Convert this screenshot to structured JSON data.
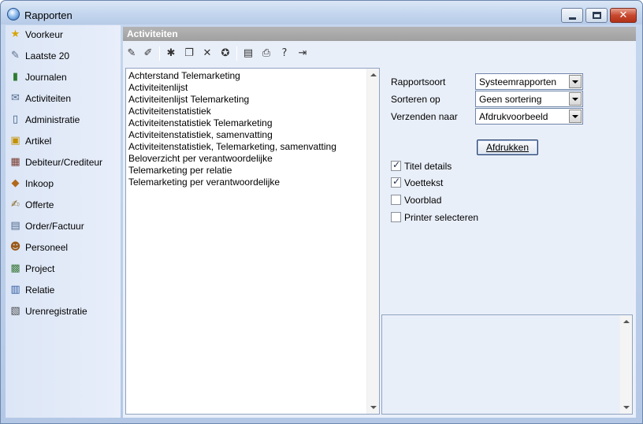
{
  "window": {
    "title": "Rapporten",
    "close_glyph": "✕"
  },
  "sidebar": {
    "items": [
      {
        "label": "Voorkeur",
        "icon": "★",
        "color": "#d8a400"
      },
      {
        "label": "Laatste 20",
        "icon": "✎",
        "color": "#5a6e8c"
      },
      {
        "label": "Journalen",
        "icon": "▮",
        "color": "#2e7d32"
      },
      {
        "label": "Activiteiten",
        "icon": "✉",
        "color": "#556b8f"
      },
      {
        "label": "Administratie",
        "icon": "▯",
        "color": "#3a5a86"
      },
      {
        "label": "Artikel",
        "icon": "▣",
        "color": "#c49000"
      },
      {
        "label": "Debiteur/Crediteur",
        "icon": "▦",
        "color": "#7a3b2e"
      },
      {
        "label": "Inkoop",
        "icon": "◆",
        "color": "#b06a1a"
      },
      {
        "label": "Offerte",
        "icon": "✍",
        "color": "#8a6a2a"
      },
      {
        "label": "Order/Factuur",
        "icon": "▤",
        "color": "#4f6a8f"
      },
      {
        "label": "Personeel",
        "icon": "☻",
        "color": "#9a5a1a"
      },
      {
        "label": "Project",
        "icon": "▩",
        "color": "#3c7a3c"
      },
      {
        "label": "Relatie",
        "icon": "▥",
        "color": "#2f5aa0"
      },
      {
        "label": "Urenregistratie",
        "icon": "▧",
        "color": "#4a4a4a"
      }
    ]
  },
  "main": {
    "header": "Activiteiten",
    "toolbar": {
      "buttons": [
        {
          "name": "edit-icon",
          "glyph": "✎"
        },
        {
          "name": "edit-alt-icon",
          "glyph": "✐"
        },
        {
          "name": "new-icon",
          "glyph": "✱"
        },
        {
          "name": "copy-icon",
          "glyph": "❐"
        },
        {
          "name": "delete-icon",
          "glyph": "✕"
        },
        {
          "name": "favorite-icon",
          "glyph": "✪"
        },
        {
          "name": "properties-icon",
          "glyph": "▤"
        },
        {
          "name": "print-icon",
          "glyph": "⎙"
        },
        {
          "name": "help-icon",
          "glyph": "?"
        },
        {
          "name": "exit-icon",
          "glyph": "⇥"
        }
      ]
    },
    "reports": [
      "Achterstand Telemarketing",
      "Activiteitenlijst",
      "Activiteitenlijst Telemarketing",
      "Activiteitenstatistiek",
      "Activiteitenstatistiek Telemarketing",
      "Activiteitenstatistiek, samenvatting",
      "Activiteitenstatistiek, Telemarketing, samenvatting",
      "Beloverzicht per verantwoordelijke",
      "Telemarketing per relatie",
      "Telemarketing per verantwoordelijke"
    ],
    "form": {
      "rapportsoort_label": "Rapportsoort",
      "rapportsoort_value": "Systeemrapporten",
      "sorteren_label": "Sorteren op",
      "sorteren_value": "Geen sortering",
      "verzenden_label": "Verzenden naar",
      "verzenden_value": "Afdrukvoorbeeld",
      "print_button": "Afdrukken"
    },
    "options": [
      {
        "label": "Titel details",
        "checked": true
      },
      {
        "label": "Voettekst",
        "checked": true
      },
      {
        "label": "Voorblad",
        "checked": false
      },
      {
        "label": "Printer selecteren",
        "checked": false
      }
    ]
  }
}
